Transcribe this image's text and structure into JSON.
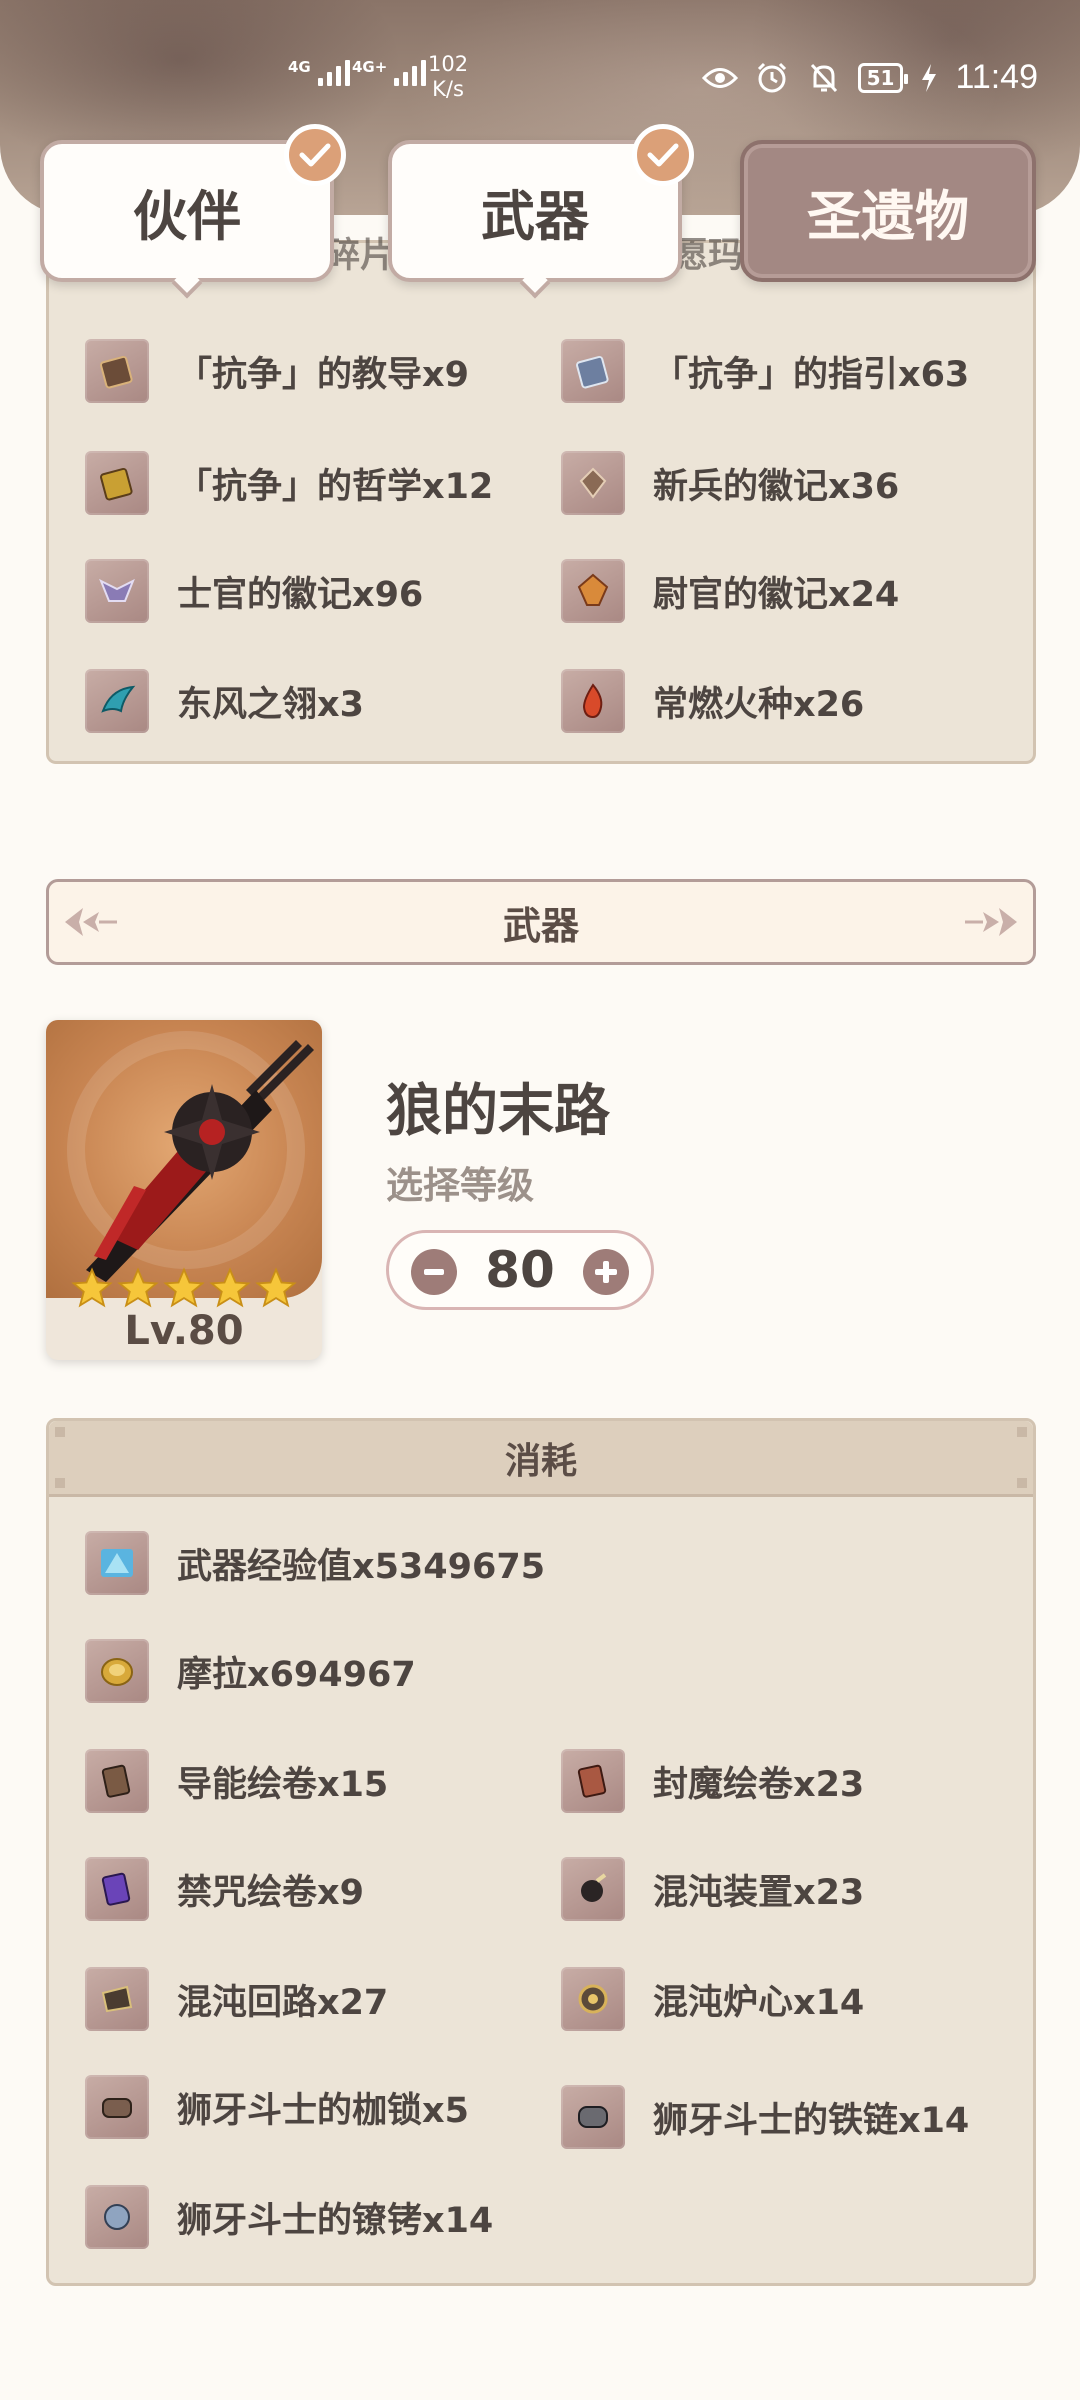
{
  "status_bar": {
    "signal1_label": "4G",
    "signal2_label": "4G+",
    "net_speed_value": "102",
    "net_speed_unit": "K/s",
    "battery": "51",
    "time": "11:49"
  },
  "tabs": [
    {
      "label": "伙伴",
      "checked": true
    },
    {
      "label": "武器",
      "checked": true
    },
    {
      "label": "圣遗物",
      "checked": false
    }
  ],
  "partial_row": [
    "碎片x",
    "愿玛"
  ],
  "top_materials": [
    {
      "label": "「抗争」的教导x9",
      "icon": "book-brown-icon"
    },
    {
      "label": "「抗争」的指引x63",
      "icon": "book-blue-icon"
    },
    {
      "label": "「抗争」的哲学x12",
      "icon": "book-gold-icon"
    },
    {
      "label": "新兵的徽记x36",
      "icon": "insignia-brown-icon"
    },
    {
      "label": "士官的徽记x96",
      "icon": "insignia-purple-icon"
    },
    {
      "label": "尉官的徽记x24",
      "icon": "insignia-gold-icon"
    },
    {
      "label": "东风之翎x3",
      "icon": "feather-icon"
    },
    {
      "label": "常燃火种x26",
      "icon": "flame-icon"
    }
  ],
  "weapon_section": {
    "title": "武器",
    "weapon_name": "狼的末路",
    "level_prompt": "选择等级",
    "level": "80",
    "level_badge": "Lv.80",
    "rarity": 5
  },
  "cost": {
    "title": "消耗",
    "items": [
      {
        "label": "武器经验值x5349675",
        "icon": "exp-crystal-icon"
      },
      {
        "label": "摩拉x694967",
        "icon": "mora-coin-icon"
      },
      {
        "label": "导能绘卷x15",
        "icon": "scroll-brown-icon"
      },
      {
        "label": "封魔绘卷x23",
        "icon": "scroll-red-icon"
      },
      {
        "label": "禁咒绘卷x9",
        "icon": "scroll-purple-icon"
      },
      {
        "label": "混沌装置x23",
        "icon": "chaos-device-icon"
      },
      {
        "label": "混沌回路x27",
        "icon": "chaos-circuit-icon"
      },
      {
        "label": "混沌炉心x14",
        "icon": "chaos-core-icon"
      },
      {
        "label": "狮牙斗士的枷锁x5",
        "icon": "shackle-icon"
      },
      {
        "label": "狮牙斗士的铁链x14",
        "icon": "chain-icon"
      },
      {
        "label": "狮牙斗士的镣铐x14",
        "icon": "handcuff-icon"
      }
    ]
  }
}
